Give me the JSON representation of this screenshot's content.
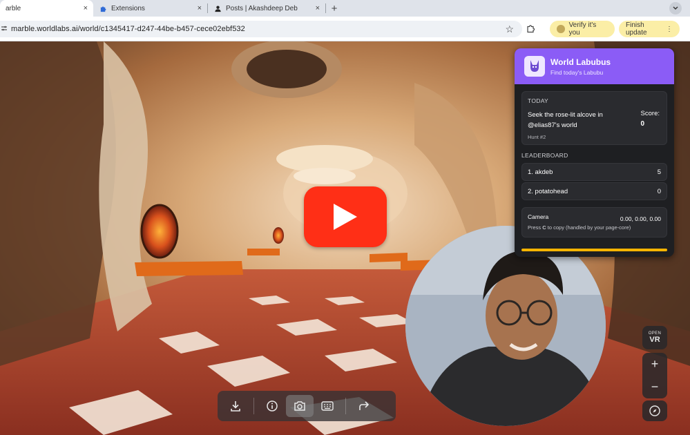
{
  "browser": {
    "tabs": [
      {
        "label": "arble",
        "icon": "marble-favicon",
        "close": "×"
      },
      {
        "label": "Extensions",
        "icon": "puzzle-icon",
        "close": "×"
      },
      {
        "label": "Posts | Akashdeep Deb",
        "icon": "user-favicon",
        "close": "×"
      }
    ],
    "new_tab": "+",
    "url": "marble.worldlabs.ai/world/c1345417-d247-44be-b457-cece02ebf532",
    "verify_label": "Verify it's you",
    "finish_label": "Finish update",
    "finish_menu": "⋮"
  },
  "panel": {
    "title": "World Labubus",
    "subtitle": "Find today's Labubu",
    "today_label": "TODAY",
    "task": "Seek the rose-lit alcove in @elias87's world",
    "hunt": "Hunt #2",
    "score_label": "Score:",
    "score_value": "0",
    "leaderboard_label": "LEADERBOARD",
    "leaderboard": [
      {
        "name": "1. akdeb",
        "score": "5"
      },
      {
        "name": "2. potatohead",
        "score": "0"
      }
    ],
    "camera_label": "Camera",
    "camera_value": "0.00, 0.00, 0.00",
    "camera_hint_key": "C",
    "camera_hint_pre": "Press ",
    "camera_hint_post": " to copy (handled by your page-core)",
    "progress": 1.0,
    "accent_color": "#8b5cf6",
    "progress_color": "#f5b400"
  },
  "controls": {
    "vr_open": "OPEN",
    "vr": "VR",
    "zoom_in": "+",
    "zoom_out": "−"
  },
  "colors": {
    "youtube_red": "#ff2f16"
  }
}
